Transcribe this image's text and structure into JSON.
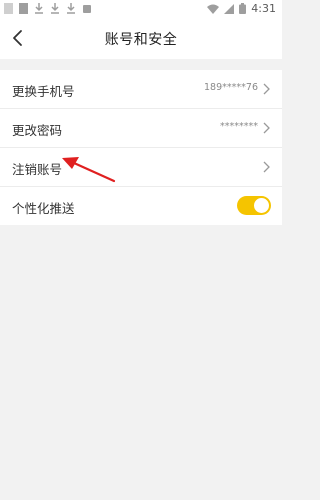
{
  "status_bar": {
    "time": "4:31"
  },
  "header": {
    "title": "账号和安全"
  },
  "settings": {
    "items": [
      {
        "label": "更换手机号",
        "value": "189*****76"
      },
      {
        "label": "更改密码",
        "value": "********"
      },
      {
        "label": "注销账号",
        "value": ""
      },
      {
        "label": "个性化推送",
        "toggle": true
      }
    ]
  },
  "colors": {
    "toggle_on": "#f5c400",
    "annotation_arrow": "#e02020"
  }
}
